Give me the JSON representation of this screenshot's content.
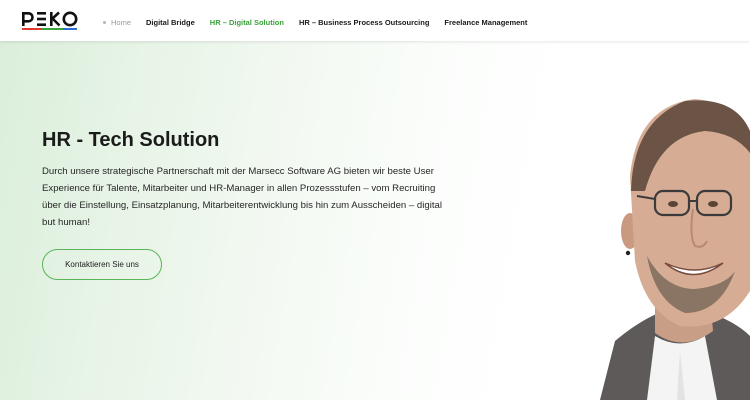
{
  "header": {
    "logo_text": "PEKO",
    "nav": {
      "home": "Home",
      "digital_bridge": "Digital Bridge",
      "hr_digital_solution": "HR – Digital Solution",
      "hr_bpo": "HR – Business Process Outsourcing",
      "freelance": "Freelance Management"
    },
    "active_item": "HR – Digital Solution",
    "colors": {
      "active": "#3aa23a",
      "logo_bar_red": "#e03a2f",
      "logo_bar_green": "#3aa23a"
    }
  },
  "hero": {
    "title": "HR - Tech Solution",
    "paragraph": "Durch unsere strategische Partnerschaft mit der Marsecc Software AG bieten wir beste User Experience für Talente, Mitarbeiter und HR-Manager in allen Prozessstufen – vom Recruiting über die Einstellung, Einsatzplanung, Mitarbeiterentwicklung bis hin zum Ausscheiden – digital but human!",
    "cta_label": "Kontaktieren Sie uns",
    "colors": {
      "accent": "#5ab55a",
      "background_start": "#dbeedb"
    }
  }
}
